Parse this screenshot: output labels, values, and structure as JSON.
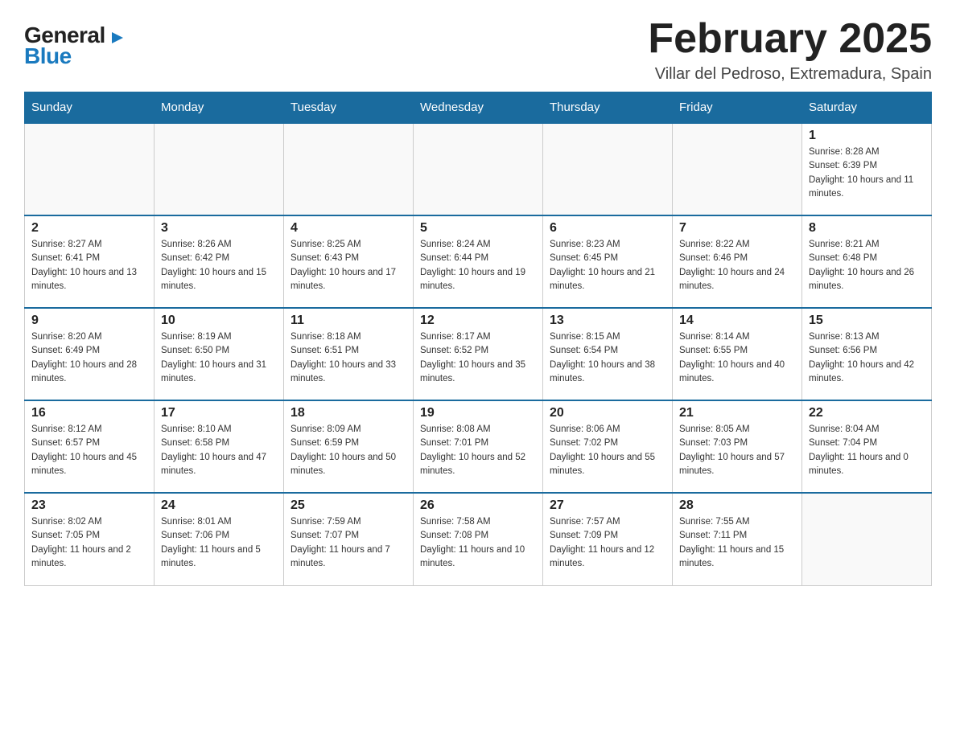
{
  "logo": {
    "general": "General",
    "blue": "Blue",
    "arrow": "▶"
  },
  "title": {
    "month": "February 2025",
    "location": "Villar del Pedroso, Extremadura, Spain"
  },
  "weekdays": [
    "Sunday",
    "Monday",
    "Tuesday",
    "Wednesday",
    "Thursday",
    "Friday",
    "Saturday"
  ],
  "weeks": [
    [
      {
        "day": "",
        "info": ""
      },
      {
        "day": "",
        "info": ""
      },
      {
        "day": "",
        "info": ""
      },
      {
        "day": "",
        "info": ""
      },
      {
        "day": "",
        "info": ""
      },
      {
        "day": "",
        "info": ""
      },
      {
        "day": "1",
        "info": "Sunrise: 8:28 AM\nSunset: 6:39 PM\nDaylight: 10 hours and 11 minutes."
      }
    ],
    [
      {
        "day": "2",
        "info": "Sunrise: 8:27 AM\nSunset: 6:41 PM\nDaylight: 10 hours and 13 minutes."
      },
      {
        "day": "3",
        "info": "Sunrise: 8:26 AM\nSunset: 6:42 PM\nDaylight: 10 hours and 15 minutes."
      },
      {
        "day": "4",
        "info": "Sunrise: 8:25 AM\nSunset: 6:43 PM\nDaylight: 10 hours and 17 minutes."
      },
      {
        "day": "5",
        "info": "Sunrise: 8:24 AM\nSunset: 6:44 PM\nDaylight: 10 hours and 19 minutes."
      },
      {
        "day": "6",
        "info": "Sunrise: 8:23 AM\nSunset: 6:45 PM\nDaylight: 10 hours and 21 minutes."
      },
      {
        "day": "7",
        "info": "Sunrise: 8:22 AM\nSunset: 6:46 PM\nDaylight: 10 hours and 24 minutes."
      },
      {
        "day": "8",
        "info": "Sunrise: 8:21 AM\nSunset: 6:48 PM\nDaylight: 10 hours and 26 minutes."
      }
    ],
    [
      {
        "day": "9",
        "info": "Sunrise: 8:20 AM\nSunset: 6:49 PM\nDaylight: 10 hours and 28 minutes."
      },
      {
        "day": "10",
        "info": "Sunrise: 8:19 AM\nSunset: 6:50 PM\nDaylight: 10 hours and 31 minutes."
      },
      {
        "day": "11",
        "info": "Sunrise: 8:18 AM\nSunset: 6:51 PM\nDaylight: 10 hours and 33 minutes."
      },
      {
        "day": "12",
        "info": "Sunrise: 8:17 AM\nSunset: 6:52 PM\nDaylight: 10 hours and 35 minutes."
      },
      {
        "day": "13",
        "info": "Sunrise: 8:15 AM\nSunset: 6:54 PM\nDaylight: 10 hours and 38 minutes."
      },
      {
        "day": "14",
        "info": "Sunrise: 8:14 AM\nSunset: 6:55 PM\nDaylight: 10 hours and 40 minutes."
      },
      {
        "day": "15",
        "info": "Sunrise: 8:13 AM\nSunset: 6:56 PM\nDaylight: 10 hours and 42 minutes."
      }
    ],
    [
      {
        "day": "16",
        "info": "Sunrise: 8:12 AM\nSunset: 6:57 PM\nDaylight: 10 hours and 45 minutes."
      },
      {
        "day": "17",
        "info": "Sunrise: 8:10 AM\nSunset: 6:58 PM\nDaylight: 10 hours and 47 minutes."
      },
      {
        "day": "18",
        "info": "Sunrise: 8:09 AM\nSunset: 6:59 PM\nDaylight: 10 hours and 50 minutes."
      },
      {
        "day": "19",
        "info": "Sunrise: 8:08 AM\nSunset: 7:01 PM\nDaylight: 10 hours and 52 minutes."
      },
      {
        "day": "20",
        "info": "Sunrise: 8:06 AM\nSunset: 7:02 PM\nDaylight: 10 hours and 55 minutes."
      },
      {
        "day": "21",
        "info": "Sunrise: 8:05 AM\nSunset: 7:03 PM\nDaylight: 10 hours and 57 minutes."
      },
      {
        "day": "22",
        "info": "Sunrise: 8:04 AM\nSunset: 7:04 PM\nDaylight: 11 hours and 0 minutes."
      }
    ],
    [
      {
        "day": "23",
        "info": "Sunrise: 8:02 AM\nSunset: 7:05 PM\nDaylight: 11 hours and 2 minutes."
      },
      {
        "day": "24",
        "info": "Sunrise: 8:01 AM\nSunset: 7:06 PM\nDaylight: 11 hours and 5 minutes."
      },
      {
        "day": "25",
        "info": "Sunrise: 7:59 AM\nSunset: 7:07 PM\nDaylight: 11 hours and 7 minutes."
      },
      {
        "day": "26",
        "info": "Sunrise: 7:58 AM\nSunset: 7:08 PM\nDaylight: 11 hours and 10 minutes."
      },
      {
        "day": "27",
        "info": "Sunrise: 7:57 AM\nSunset: 7:09 PM\nDaylight: 11 hours and 12 minutes."
      },
      {
        "day": "28",
        "info": "Sunrise: 7:55 AM\nSunset: 7:11 PM\nDaylight: 11 hours and 15 minutes."
      },
      {
        "day": "",
        "info": ""
      }
    ]
  ]
}
